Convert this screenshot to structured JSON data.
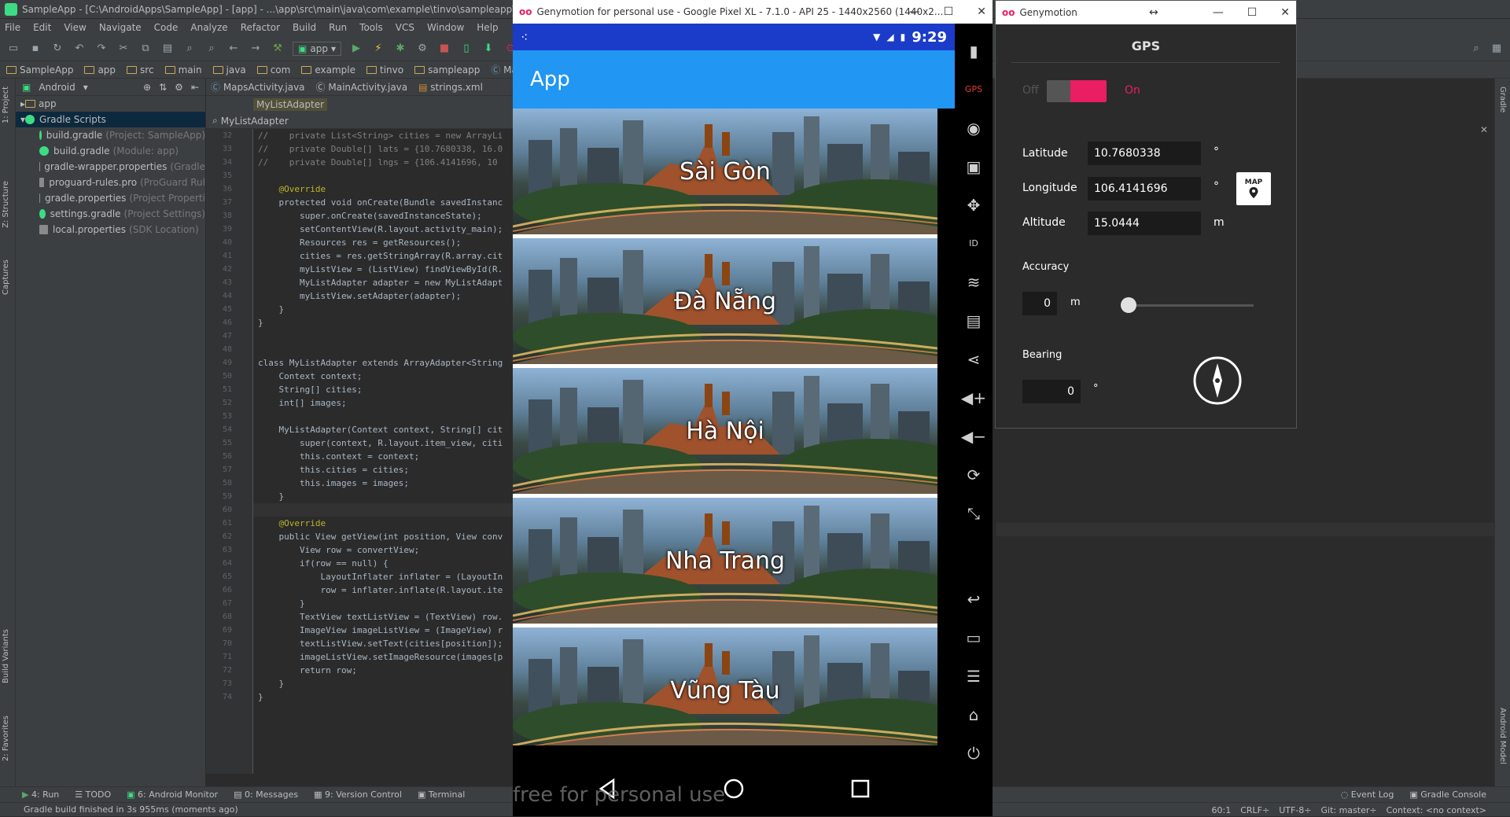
{
  "ide": {
    "title": "SampleApp - [C:\\AndroidApps\\SampleApp] - [app] - ...\\app\\src\\main\\java\\com\\example\\tinvo\\sampleapp\\MainActi",
    "menu": [
      "File",
      "Edit",
      "View",
      "Navigate",
      "Code",
      "Analyze",
      "Refactor",
      "Build",
      "Run",
      "Tools",
      "VCS",
      "Window",
      "Help"
    ],
    "run_config": "app",
    "nav_path": [
      "SampleApp",
      "app",
      "src",
      "main",
      "java",
      "com",
      "example",
      "tinvo",
      "sampleapp",
      "MainA"
    ],
    "project_view": "Android",
    "tree": [
      {
        "label": "app",
        "dim": ""
      },
      {
        "label": "Gradle Scripts",
        "dim": ""
      },
      {
        "label": "build.gradle",
        "dim": "(Project: SampleApp)"
      },
      {
        "label": "build.gradle",
        "dim": "(Module: app)"
      },
      {
        "label": "gradle-wrapper.properties",
        "dim": "(Gradle"
      },
      {
        "label": "proguard-rules.pro",
        "dim": "(ProGuard Rul"
      },
      {
        "label": "gradle.properties",
        "dim": "(Project Properti"
      },
      {
        "label": "settings.gradle",
        "dim": "(Project Settings)"
      },
      {
        "label": "local.properties",
        "dim": "(SDK Location)"
      }
    ],
    "tabs": [
      {
        "label": "MapsActivity.java"
      },
      {
        "label": "MainActivity.java"
      },
      {
        "label": "strings.xml"
      }
    ],
    "breadcrumb": "MyListAdapter",
    "search_value": "MyListAdapter",
    "left_tool_tabs": [
      "1: Project",
      "Z: Structure",
      "Captures",
      "Build Variants",
      "2: Favorites"
    ],
    "right_tool_tabs": [
      "Gradle",
      "Android Model"
    ],
    "bottom_tools": [
      "4: Run",
      "TODO",
      "6: Android Monitor",
      "0: Messages",
      "9: Version Control",
      "Terminal",
      "Event Log",
      "Gradle Console"
    ],
    "status_message": "Gradle build finished in 3s 955ms (moments ago)",
    "status_right": [
      "60:1",
      "CRLF÷",
      "UTF-8÷",
      "Git: master÷",
      "Context: <no context>"
    ]
  },
  "code_lines": [
    {
      "n": "32",
      "t": "//    private List<String> cities = new ArrayLi"
    },
    {
      "n": "33",
      "t": "//    private Double[] lats = {10.7680338, 16.0"
    },
    {
      "n": "34",
      "t": "//    private Double[] lngs = {106.4141696, 10"
    },
    {
      "n": "35",
      "t": ""
    },
    {
      "n": "36",
      "t": "    @Override"
    },
    {
      "n": "37",
      "t": "    protected void onCreate(Bundle savedInstanc"
    },
    {
      "n": "38",
      "t": "        super.onCreate(savedInstanceState);"
    },
    {
      "n": "39",
      "t": "        setContentView(R.layout.activity_main);"
    },
    {
      "n": "40",
      "t": "        Resources res = getResources();"
    },
    {
      "n": "41",
      "t": "        cities = res.getStringArray(R.array.cit"
    },
    {
      "n": "42",
      "t": "        myListView = (ListView) findViewById(R."
    },
    {
      "n": "43",
      "t": "        MyListAdapter adapter = new MyListAdapt"
    },
    {
      "n": "44",
      "t": "        myListView.setAdapter(adapter);"
    },
    {
      "n": "45",
      "t": "    }"
    },
    {
      "n": "46",
      "t": "}"
    },
    {
      "n": "47",
      "t": ""
    },
    {
      "n": "48",
      "t": ""
    },
    {
      "n": "49",
      "t": "class MyListAdapter extends ArrayAdapter<String"
    },
    {
      "n": "50",
      "t": "    Context context;"
    },
    {
      "n": "51",
      "t": "    String[] cities;"
    },
    {
      "n": "52",
      "t": "    int[] images;"
    },
    {
      "n": "53",
      "t": ""
    },
    {
      "n": "54",
      "t": "    MyListAdapter(Context context, String[] cit"
    },
    {
      "n": "55",
      "t": "        super(context, R.layout.item_view, citi"
    },
    {
      "n": "56",
      "t": "        this.context = context;"
    },
    {
      "n": "57",
      "t": "        this.cities = cities;"
    },
    {
      "n": "58",
      "t": "        this.images = images;"
    },
    {
      "n": "59",
      "t": "    }"
    },
    {
      "n": "60",
      "t": ""
    },
    {
      "n": "61",
      "t": "    @Override"
    },
    {
      "n": "62",
      "t": "    public View getView(int position, View conv"
    },
    {
      "n": "63",
      "t": "        View row = convertView;"
    },
    {
      "n": "64",
      "t": "        if(row == null) {"
    },
    {
      "n": "65",
      "t": "            LayoutInflater inflater = (LayoutIn"
    },
    {
      "n": "66",
      "t": "            row = inflater.inflate(R.layout.ite"
    },
    {
      "n": "67",
      "t": "        }"
    },
    {
      "n": "68",
      "t": "        TextView textListView = (TextView) row."
    },
    {
      "n": "69",
      "t": "        ImageView imageListView = (ImageView) r"
    },
    {
      "n": "70",
      "t": "        textListView.setText(cities[position]);"
    },
    {
      "n": "71",
      "t": "        imageListView.setImageResource(images[p"
    },
    {
      "n": "72",
      "t": "        return row;"
    },
    {
      "n": "73",
      "t": "    }"
    },
    {
      "n": "74",
      "t": "}"
    }
  ],
  "emulator": {
    "title": "Genymotion for personal use - Google Pixel XL - 7.1.0 - API 25 - 1440x2560 (1440x2...",
    "time": "9:29",
    "app_title": "App",
    "cities": [
      "Sài Gòn",
      "Đà Nẵng",
      "Hà Nội",
      "Nha Trang",
      "Vũng Tàu"
    ],
    "watermark": "free for personal use",
    "side_icons": [
      "battery-icon",
      "gps-icon",
      "webcam-icon",
      "clapper-icon",
      "move-icon",
      "id-icon",
      "rss-icon",
      "sms-icon",
      "share-icon",
      "volume-up-icon",
      "volume-down-icon",
      "rotate-icon",
      "pixel-perfect-icon",
      "back-icon",
      "recent-apps-icon",
      "menu-icon",
      "home-icon",
      "power-icon"
    ],
    "side_glyphs": [
      "▮",
      "GPS",
      "◉",
      "▣",
      "✥",
      "ID",
      "≋",
      "▤",
      "⋖",
      "◀+",
      "◀−",
      "⟳",
      "⤡",
      "↩",
      "▭",
      "☰",
      "⌂",
      "⏻"
    ]
  },
  "gps": {
    "window_title": "Genymotion",
    "heading": "GPS",
    "toggle_off": "Off",
    "toggle_on": "On",
    "enabled": true,
    "latitude_label": "Latitude",
    "latitude": "10.7680338",
    "longitude_label": "Longitude",
    "longitude": "106.4141696",
    "altitude_label": "Altitude",
    "altitude": "15.0444",
    "altitude_unit": "m",
    "degree_unit": "°",
    "map_button": "MAP",
    "accuracy_label": "Accuracy",
    "accuracy": "0",
    "accuracy_unit": "m",
    "accuracy_slider_fraction": 0,
    "bearing_label": "Bearing",
    "bearing": "0",
    "bearing_unit": "°"
  },
  "colors": {
    "accent": "#e91e63",
    "app_bar": "#2196f3",
    "status_bar": "#1b3cc8"
  }
}
